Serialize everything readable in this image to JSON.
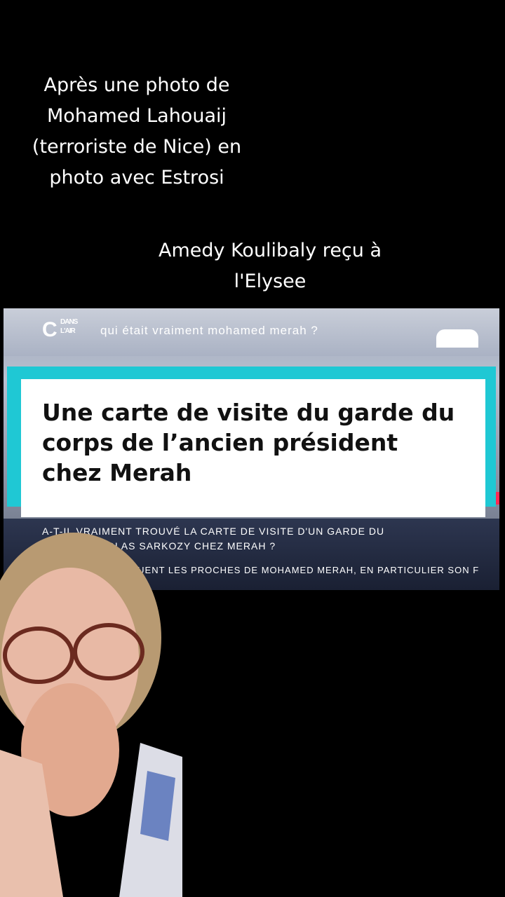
{
  "captions": {
    "first": "Après une photo de\nMohamed Lahouaij\n(terroriste de Nice) en\nphoto avec Estrosi",
    "second": "Amedy Koulibaly reçu à\nl'Elysee"
  },
  "tv_screenshot": {
    "logo_main": "C",
    "logo_top": "DANS",
    "logo_bottom": "L'AIR",
    "question": "QUI ÉTAIT VRAIMENT MOHAMED MERAH ?",
    "subtitle_line_1": "A-T-IL VRAIMENT TROUVÉ LA CARTE DE VISITE D'UN GARDE DU",
    "subtitle_line_2": "NICOLAS SARKOZY CHEZ MERAH ?",
    "ticker": "USQUENT LES PROCHES DE MOHAMED MERAH, EN PARTICULIER SON F"
  },
  "banner": {
    "text": "Une carte de visite du garde du corps de l’ancien président chez Merah"
  },
  "colors": {
    "background": "#000000",
    "banner_accent": "#1fc8d4",
    "red_strip": "#ff2b54"
  }
}
